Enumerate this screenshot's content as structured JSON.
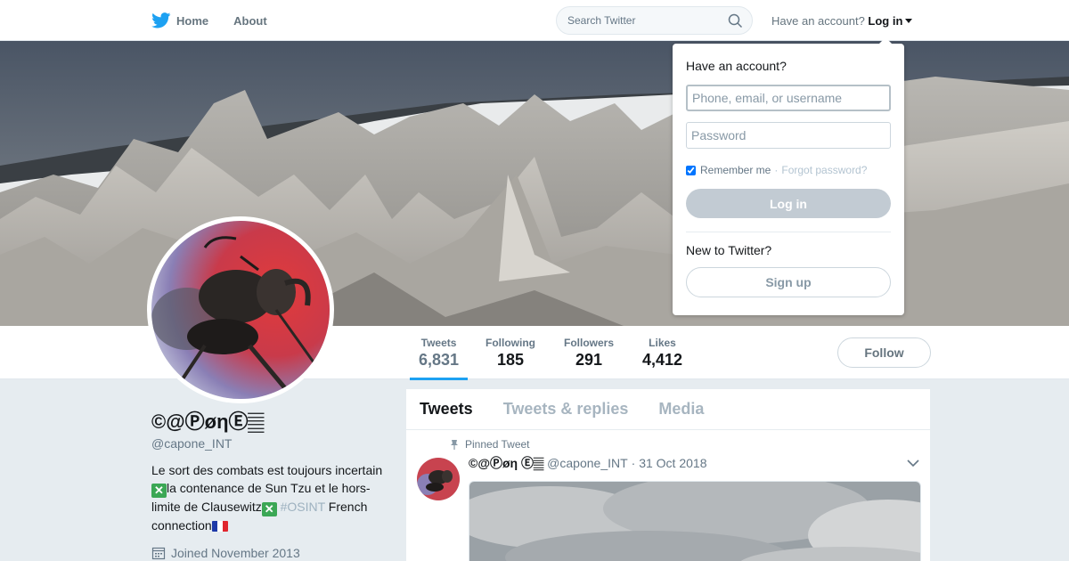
{
  "topbar": {
    "nav": [
      {
        "label": "Home",
        "icon": "twitter-bird-icon"
      },
      {
        "label": "About"
      }
    ],
    "search_placeholder": "Search Twitter",
    "account_prompt": "Have an account?",
    "login_label": "Log in"
  },
  "dropdown": {
    "title": "Have an account?",
    "username_placeholder": "Phone, email, or username",
    "password_placeholder": "Password",
    "remember_label": "Remember me",
    "separator": "·",
    "forgot_label": "Forgot password?",
    "remember_checked": true,
    "login_button": "Log in",
    "new_prompt": "New to Twitter?",
    "signup_button": "Sign up"
  },
  "profile": {
    "name": "©@ⓅøηⒺ𝄛",
    "handle": "@capone_INT",
    "bio": {
      "line1": "Le sort des combats est toujours incertain ",
      "line2": "la contenance de Sun Tzu et le hors-limite de Clausewitz",
      "hashtag": "#OSINT",
      "line3": " French connection"
    },
    "joined": "Joined November 2013",
    "follow_button": "Follow"
  },
  "stats": [
    {
      "label": "Tweets",
      "value": "6,831",
      "active": true
    },
    {
      "label": "Following",
      "value": "185"
    },
    {
      "label": "Followers",
      "value": "291"
    },
    {
      "label": "Likes",
      "value": "4,412"
    }
  ],
  "timeline": {
    "tabs": [
      "Tweets",
      "Tweets & replies",
      "Media"
    ],
    "active_tab": "Tweets",
    "pinned_label": "Pinned Tweet",
    "tweet": {
      "name": "©@Ⓟøη Ⓔ𝄛",
      "handle": "@capone_INT",
      "date": "· 31 Oct 2018"
    }
  },
  "colors": {
    "accent": "#1da1f2",
    "background": "#e6ecf0",
    "login_button": "#c2cbd3"
  }
}
